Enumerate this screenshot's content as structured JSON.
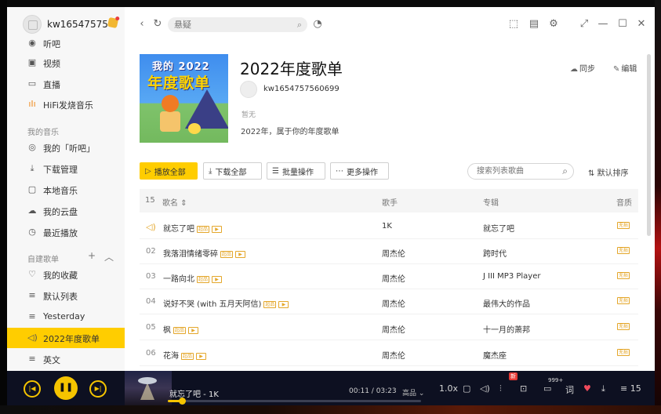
{
  "user": {
    "name": "kw16547575..."
  },
  "sidebar": {
    "top_items": [
      {
        "label": "听吧"
      },
      {
        "label": "视频"
      },
      {
        "label": "直播"
      },
      {
        "label": "HiFi发烧音乐"
      }
    ],
    "my_music_label": "我的音乐",
    "my_music_items": [
      {
        "label": "我的「听吧」"
      },
      {
        "label": "下载管理"
      },
      {
        "label": "本地音乐"
      },
      {
        "label": "我的云盘"
      },
      {
        "label": "最近播放"
      }
    ],
    "custom_label": "自建歌单",
    "custom_items": [
      {
        "label": "我的收藏"
      },
      {
        "label": "默认列表"
      },
      {
        "label": "Yesterday"
      },
      {
        "label": "2022年度歌单"
      },
      {
        "label": "英文"
      }
    ]
  },
  "search": {
    "placeholder": "悬疑"
  },
  "playlist": {
    "cover_line1": "我的 2022",
    "cover_line2": "年度歌单",
    "title": "2022年度歌单",
    "owner": "kw1654757560699",
    "tag": "暂无",
    "description": "2022年，属于你的年度歌单",
    "sync_label": "同步",
    "edit_label": "编辑"
  },
  "actions": {
    "play_all": "播放全部",
    "download_all": "下载全部",
    "batch": "批量操作",
    "more": "更多操作",
    "search_placeholder": "搜索列表歌曲",
    "sort": "默认排序"
  },
  "table": {
    "count": "15",
    "headers": {
      "title": "歌名",
      "artist": "歌手",
      "album": "专辑",
      "quality": "音质"
    },
    "quality_tag": "超品",
    "lossless_tag": "无损",
    "rows": [
      {
        "idx": "",
        "title": "就忘了吧",
        "artist": "1K",
        "album": "就忘了吧",
        "playing": true
      },
      {
        "idx": "02",
        "title": "我落泪情绪零碎",
        "artist": "周杰伦",
        "album": "跨时代"
      },
      {
        "idx": "03",
        "title": "一路向北",
        "artist": "周杰伦",
        "album": "J III MP3 Player"
      },
      {
        "idx": "04",
        "title": "说好不哭 (with 五月天阿信)",
        "artist": "周杰伦",
        "album": "最伟大的作品"
      },
      {
        "idx": "05",
        "title": "枫",
        "artist": "周杰伦",
        "album": "十一月的萧邦"
      },
      {
        "idx": "06",
        "title": "花海",
        "artist": "周杰伦",
        "album": "魔杰座"
      }
    ]
  },
  "player": {
    "now_playing": "就忘了吧 - 1K",
    "time": "00:11 / 03:23",
    "quality": "高品",
    "speed": "1.0x",
    "new_badge": "新",
    "comment_count": "999+",
    "lyric_label": "词",
    "queue_count": "15",
    "progress": 0.055
  },
  "colors": {
    "accent": "#ffcd00",
    "player_bg": "#0d1021",
    "tag": "#e4a72b"
  }
}
